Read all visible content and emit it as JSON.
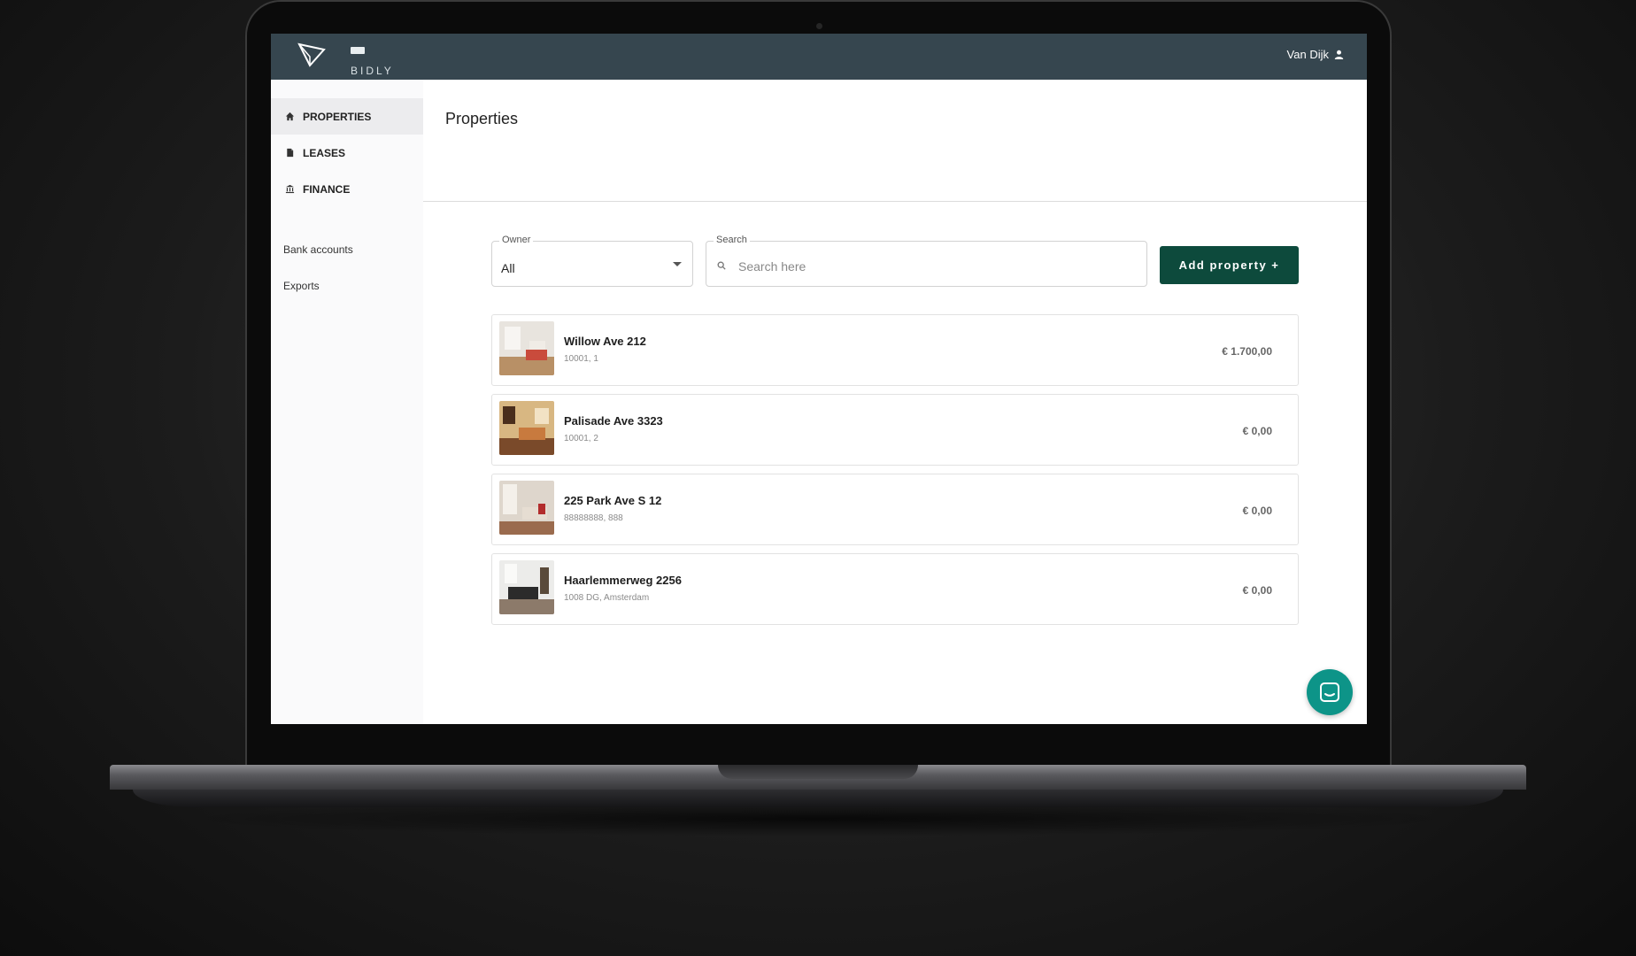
{
  "app": {
    "logo_text": "BIDLY",
    "user_name": "Van Dijk"
  },
  "sidebar": {
    "items": [
      {
        "label": "PROPERTIES",
        "icon": "home-icon",
        "active": true
      },
      {
        "label": "LEASES",
        "icon": "document-icon",
        "active": false
      },
      {
        "label": "FINANCE",
        "icon": "bank-icon",
        "active": false
      }
    ],
    "links": [
      {
        "label": "Bank accounts"
      },
      {
        "label": "Exports"
      }
    ]
  },
  "main": {
    "title": "Properties",
    "owner_filter": {
      "label": "Owner",
      "value": "All"
    },
    "search": {
      "label": "Search",
      "placeholder": "Search here",
      "value": ""
    },
    "add_button": "Add property +",
    "properties": [
      {
        "name": "Willow Ave 212",
        "subtitle": "10001, 1",
        "price": "€ 1.700,00",
        "thumb_colors": [
          "#e8e4de",
          "#b89066",
          "#c94b3c"
        ]
      },
      {
        "name": "Palisade Ave 3323",
        "subtitle": "10001, 2",
        "price": "€ 0,00",
        "thumb_colors": [
          "#d8b782",
          "#7a4a2a",
          "#c87a3e"
        ]
      },
      {
        "name": "225 Park Ave S 12",
        "subtitle": "88888888, 888",
        "price": "€ 0,00",
        "thumb_colors": [
          "#ded6cc",
          "#9a6b4e",
          "#b22c2c"
        ]
      },
      {
        "name": "Haarlemmerweg 2256",
        "subtitle": "1008 DG, Amsterdam",
        "price": "€ 0,00",
        "thumb_colors": [
          "#ececea",
          "#2b2b2b",
          "#8c7a6a"
        ]
      }
    ]
  },
  "colors": {
    "topbar": "#36464f",
    "accent_button": "#0d4a3c",
    "chat_button": "#0d9488"
  }
}
